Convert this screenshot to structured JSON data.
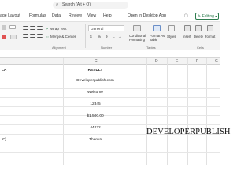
{
  "search": {
    "text": "Search (Alt + Q)",
    "icon": "search-icon"
  },
  "tabs": [
    {
      "label": "age Layout"
    },
    {
      "label": "Formulas"
    },
    {
      "label": "Data"
    },
    {
      "label": "Review"
    },
    {
      "label": "View"
    },
    {
      "label": "Help"
    },
    {
      "label": "Open in Desktop App"
    }
  ],
  "editing_label": "Editing",
  "ribbon": {
    "wrap_text": "Wrap Text",
    "merge_center": "Merge & Center",
    "number_format": "General",
    "currency": "$",
    "conditional_formatting": "Conditional Formatting",
    "format_as_table": "Format As Table",
    "styles": "Styles",
    "insert": "Insert",
    "delete": "Delete",
    "format": "Format",
    "groups": {
      "alignment": "Alignment",
      "number": "Number",
      "tables": "Tables",
      "cells": "Cells"
    }
  },
  "columns": [
    "C",
    "D",
    "E",
    "F",
    "G"
  ],
  "rows": {
    "header_left": "LA",
    "header_result": "RESULT",
    "results": [
      "Developerpublish.com",
      "Welcome",
      "12345",
      "$1,500.00",
      "44222",
      "Thanks"
    ],
    "left_fragment": "s\")"
  },
  "overlay_text": "DEVELOPERPUBLISH"
}
